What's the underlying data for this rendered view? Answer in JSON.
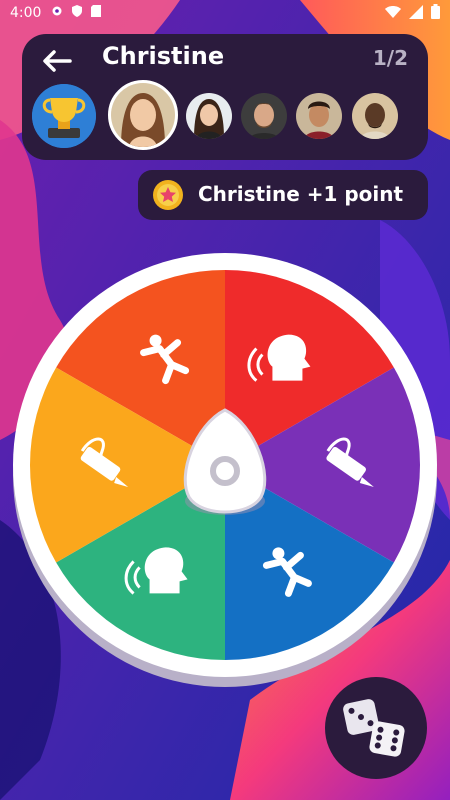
{
  "status_bar": {
    "time": "4:00",
    "left_icons": [
      "gear-icon",
      "play-protect-icon",
      "sd-card-icon"
    ],
    "right_icons": [
      "wifi-icon",
      "signal-icon",
      "battery-icon"
    ]
  },
  "header": {
    "player_name": "Christine",
    "round": "1/2",
    "players": [
      "avatar-christine",
      "avatar-woman",
      "avatar-man-beard",
      "avatar-man-smiling",
      "avatar-man-dark"
    ]
  },
  "score": {
    "text": "Christine +1 point"
  },
  "wheel": {
    "segments": [
      {
        "name": "act-out",
        "color": "#f4531f",
        "icon": "running-figure-icon"
      },
      {
        "name": "speak",
        "color": "#ef2b2b",
        "icon": "speaking-head-icon"
      },
      {
        "name": "draw-right",
        "color": "#7a30b7",
        "icon": "pencil-draw-icon"
      },
      {
        "name": "mime",
        "color": "#1470c4",
        "icon": "handstand-figure-icon"
      },
      {
        "name": "hum",
        "color": "#2db37f",
        "icon": "humming-head-icon"
      },
      {
        "name": "draw",
        "color": "#fba71c",
        "icon": "pencil-draw-icon"
      }
    ]
  },
  "colors": {
    "panel": "#2b1b3d",
    "background_primary": "#2a1a8a",
    "accent_pink": "#ff3e8a",
    "accent_orange": "#ff8c3a"
  }
}
